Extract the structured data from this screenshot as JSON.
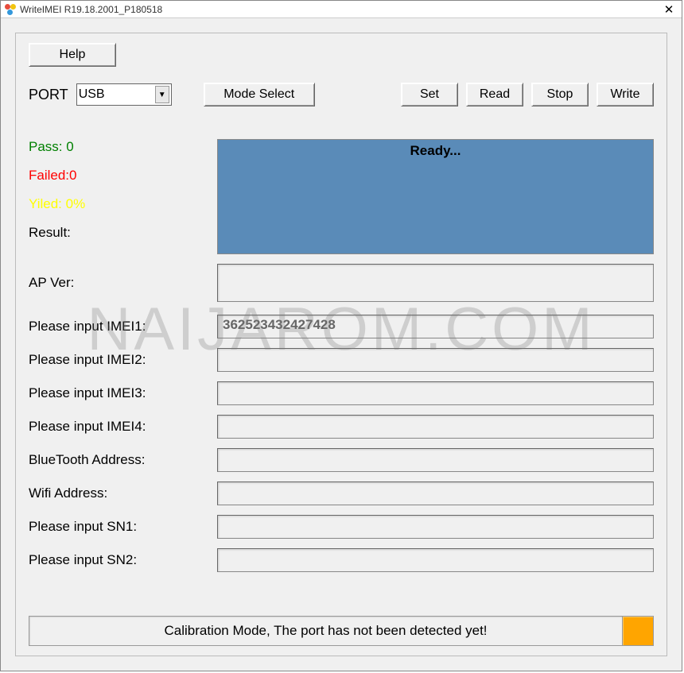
{
  "window": {
    "title": "WriteIMEI R19.18.2001_P180518",
    "close_glyph": "✕"
  },
  "toolbar": {
    "help_label": "Help",
    "port_label": "PORT",
    "port_value": "USB",
    "mode_select_label": "Mode Select",
    "set_label": "Set",
    "read_label": "Read",
    "stop_label": "Stop",
    "write_label": "Write"
  },
  "stats": {
    "pass_text": "Pass:  0",
    "failed_text": "Failed:0",
    "yield_text": "Yiled: 0%",
    "result_text": "Result:"
  },
  "ready_box_text": "Ready...",
  "fields": {
    "apver_label": "AP Ver:",
    "apver_value": "",
    "imei1_label": "Please input IMEI1:",
    "imei1_value": "362523432427428",
    "imei2_label": "Please input IMEI2:",
    "imei2_value": "",
    "imei3_label": "Please input IMEI3:",
    "imei3_value": "",
    "imei4_label": "Please input IMEI4:",
    "imei4_value": "",
    "bt_label": "BlueTooth Address:",
    "bt_value": "",
    "wifi_label": "Wifi Address:",
    "wifi_value": "",
    "sn1_label": "Please input SN1:",
    "sn1_value": "",
    "sn2_label": "Please input SN2:",
    "sn2_value": ""
  },
  "statusbar": {
    "text": "Calibration Mode, The port has not been detected yet!",
    "indicator_color": "#ffa500"
  },
  "watermark": "NAIJAROM.COM"
}
